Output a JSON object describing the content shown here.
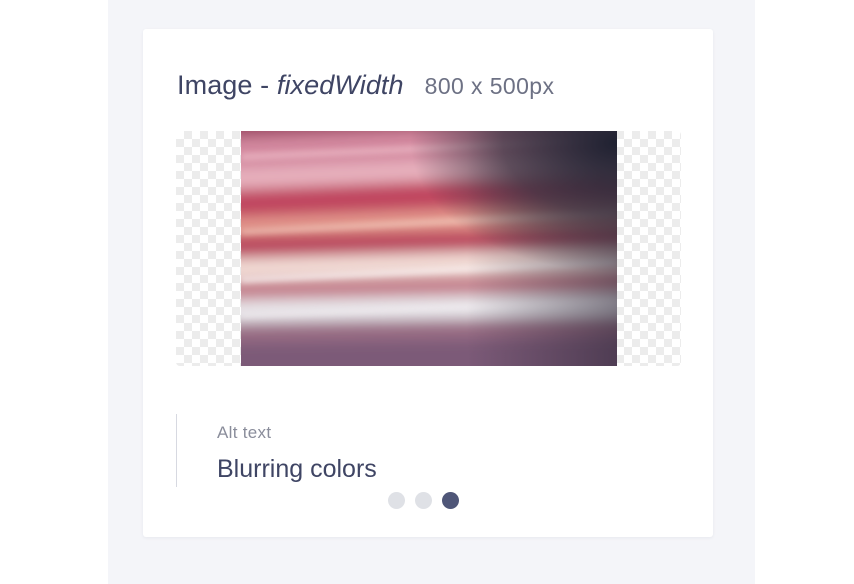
{
  "card": {
    "title_prefix": "Image - ",
    "title_variant": "fixedWidth",
    "dimensions": "800 x 500px"
  },
  "image": {
    "icon": "blurred-colors-photo",
    "alt_label": "Alt text",
    "alt_value": "Blurring colors"
  },
  "pagination": {
    "total": 3,
    "current": 3
  },
  "colors": {
    "page_background": "#f4f5f9",
    "card": "#ffffff",
    "title_text": "#3f4564",
    "secondary_text": "#6d7184",
    "active_dot": "#4f5678",
    "inactive_dot": "#dfe1e6"
  }
}
